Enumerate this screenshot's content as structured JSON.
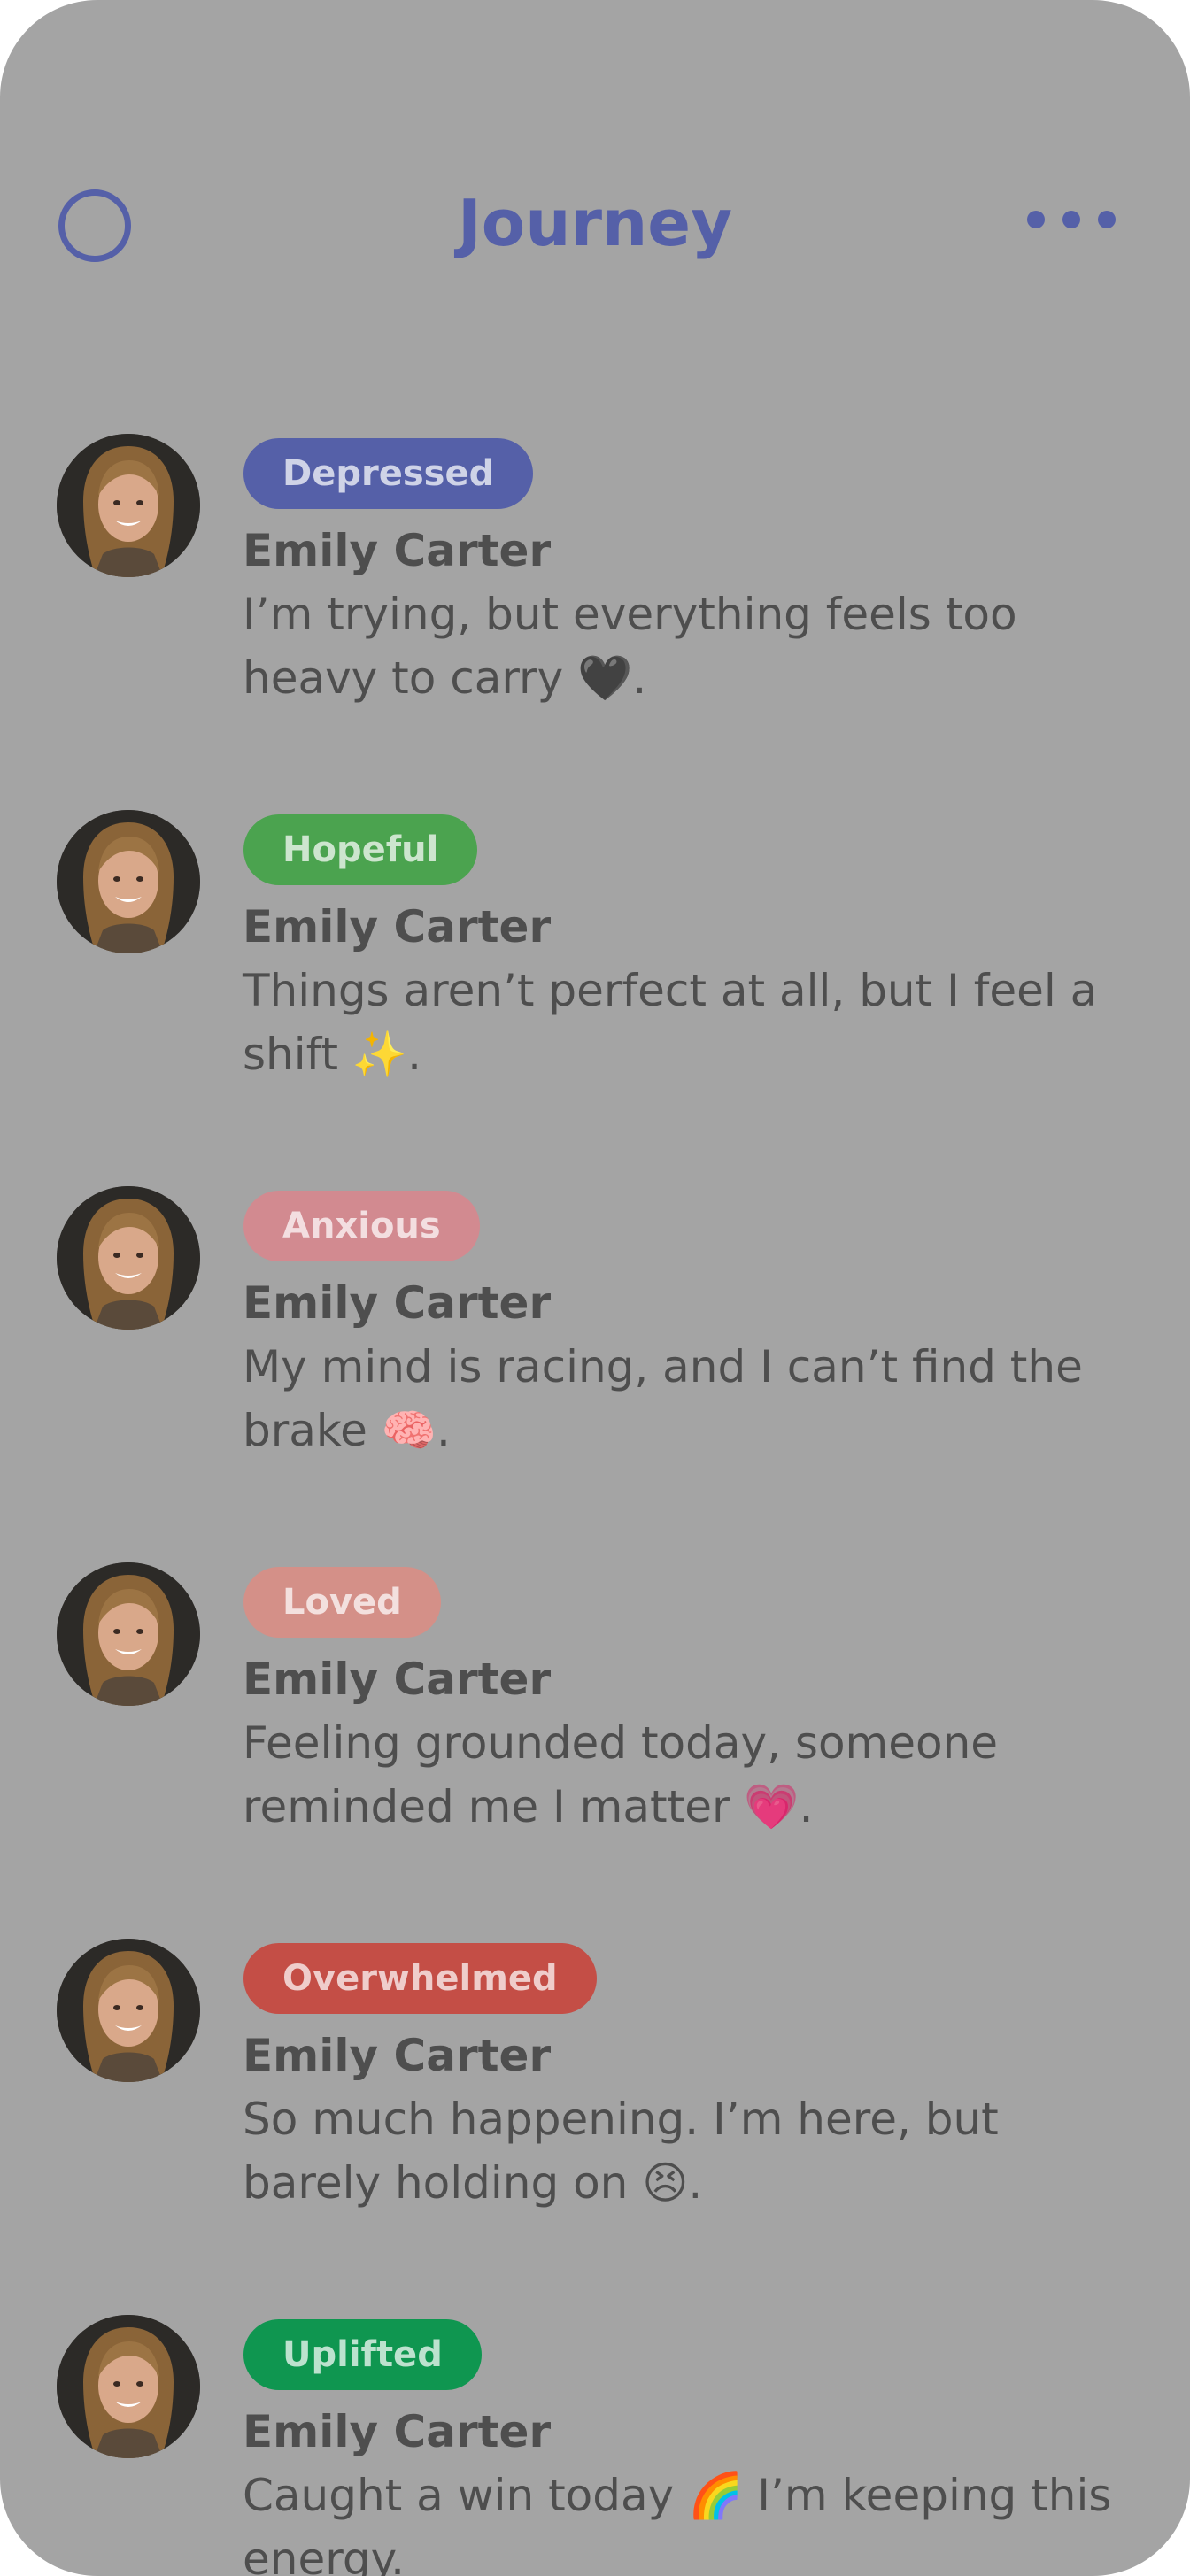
{
  "header": {
    "title": "Journey",
    "left_icon": "circle-icon",
    "right_icon": "more-horizontal-icon",
    "accent_color": "#5560a8"
  },
  "entries": [
    {
      "mood": "Depressed",
      "mood_color": "#5560a8",
      "author": "Emily Carter",
      "text": "I’m trying, but everything feels too heavy to carry 🖤."
    },
    {
      "mood": "Hopeful",
      "mood_color": "#4ba34f",
      "author": "Emily Carter",
      "text": "Things aren’t perfect at all, but I feel a shift ✨."
    },
    {
      "mood": "Anxious",
      "mood_color": "#d28a90",
      "author": "Emily Carter",
      "text": "My mind is racing, and I can’t find the brake 🧠."
    },
    {
      "mood": "Loved",
      "mood_color": "#d49088",
      "author": "Emily Carter",
      "text": "Feeling grounded today, someone reminded me I matter 💗."
    },
    {
      "mood": "Overwhelmed",
      "mood_color": "#c44e46",
      "author": "Emily Carter",
      "text": "So much happening. I’m here, but barely holding on 😣."
    },
    {
      "mood": "Uplifted",
      "mood_color": "#0f9650",
      "author": "Emily Carter",
      "text": "Caught a win today 🌈 I’m keeping this energy."
    }
  ]
}
